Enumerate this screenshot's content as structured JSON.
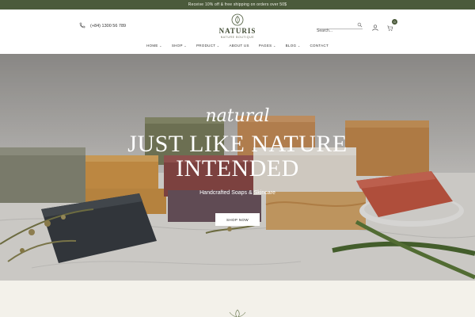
{
  "announcement": "Receive 10% off & free shipping on orders over 50$",
  "header": {
    "phone": "(+84) 1300 56 789",
    "logo_name": "NATURIS",
    "logo_sub": "NATURE BOUTIQUE",
    "search_placeholder": "Search...",
    "cart_count": "0"
  },
  "nav": {
    "items": [
      {
        "label": "HOME",
        "has_dropdown": true
      },
      {
        "label": "SHOP",
        "has_dropdown": true
      },
      {
        "label": "PRODUCT",
        "has_dropdown": true
      },
      {
        "label": "ABOUT US",
        "has_dropdown": false
      },
      {
        "label": "PAGES",
        "has_dropdown": true
      },
      {
        "label": "BLOG",
        "has_dropdown": true
      },
      {
        "label": "CONTACT",
        "has_dropdown": false
      }
    ]
  },
  "hero": {
    "script": "natural",
    "headline_line1": "JUST LIKE NATURE",
    "headline_line2": "INTENDED",
    "subline": "Handcrafted Soaps & Skincare",
    "button": "SHOP NOW"
  },
  "colors": {
    "brand_green": "#4b5a3b",
    "section_bg": "#f3f1ea"
  },
  "icons": [
    "phone-icon",
    "search-icon",
    "user-icon",
    "cart-icon",
    "logo-emblem-icon",
    "chevron-down-icon"
  ]
}
